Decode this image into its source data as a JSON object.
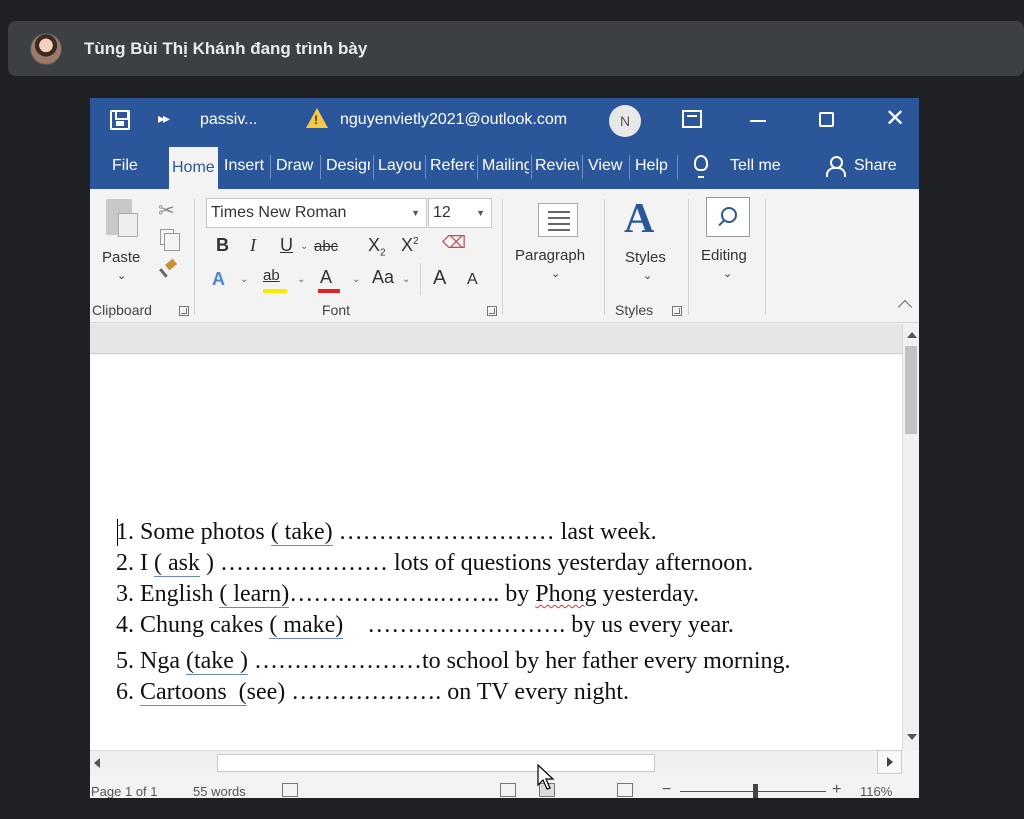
{
  "presenter": {
    "name": "Tùng Bùi Thị Khánh đang trình bày"
  },
  "titlebar": {
    "doc_name": "passiv...",
    "warning_symbol": "!",
    "account": "nguyenvietly2021@outlook.com",
    "account_initial": "N",
    "close_symbol": "✕"
  },
  "tabs": [
    "File",
    "Home",
    "Insert",
    "Draw",
    "Design",
    "Layout",
    "References",
    "Mailings",
    "Review",
    "View",
    "Help",
    "Tell me",
    "Share"
  ],
  "ribbon": {
    "clipboard": {
      "paste": "Paste",
      "label": "Clipboard"
    },
    "font": {
      "font_name": "Times New Roman",
      "font_size": "12",
      "bold": "B",
      "italic": "I",
      "underline": "U",
      "strike": "abc",
      "subscript": "X",
      "sub_mark": "2",
      "superscript": "X",
      "super_mark": "2",
      "highlight": "ab",
      "font_color": "A",
      "change_case": "Aa",
      "grow": "A",
      "shrink": "A",
      "label": "Font"
    },
    "paragraph": {
      "label": "Paragraph"
    },
    "styles": {
      "button": "Styles",
      "label": "Styles"
    },
    "editing": {
      "label": "Editing"
    }
  },
  "document": {
    "lines": [
      {
        "num": "1. ",
        "pre": "Some photos ",
        "verb": "( take)",
        "post": " ……………………… last week."
      },
      {
        "num": "2. ",
        "pre": "I ",
        "verb": "( ask",
        "post": " ) ………………… lots of questions yesterday afternoon."
      },
      {
        "num": "3. ",
        "pre": "English ",
        "verb": "( learn)",
        "mid": "……………….…….. by ",
        "name": "Phong",
        "post": " yesterday."
      },
      {
        "num": "4. ",
        "pre": "Chung cakes ",
        "verb": "( make)",
        "post": "    ……………………. by us every year."
      },
      {
        "num": "5. ",
        "pre": "Nga ",
        "verb": "(take )",
        "post": " …………………to school by her father every morning."
      },
      {
        "num": "6. ",
        "pre": "",
        "verb": "Cartoons  (",
        "post": "see) ………………. on TV every night."
      }
    ]
  },
  "statusbar": {
    "page": "Page 1 of 1",
    "words": "55 words",
    "zoom_minus": "−",
    "zoom_plus": "+",
    "zoom": "116%"
  },
  "colors": {
    "word_blue": "#2b579a",
    "presenter_bg": "#3c4043",
    "screen_bg": "#202124"
  }
}
